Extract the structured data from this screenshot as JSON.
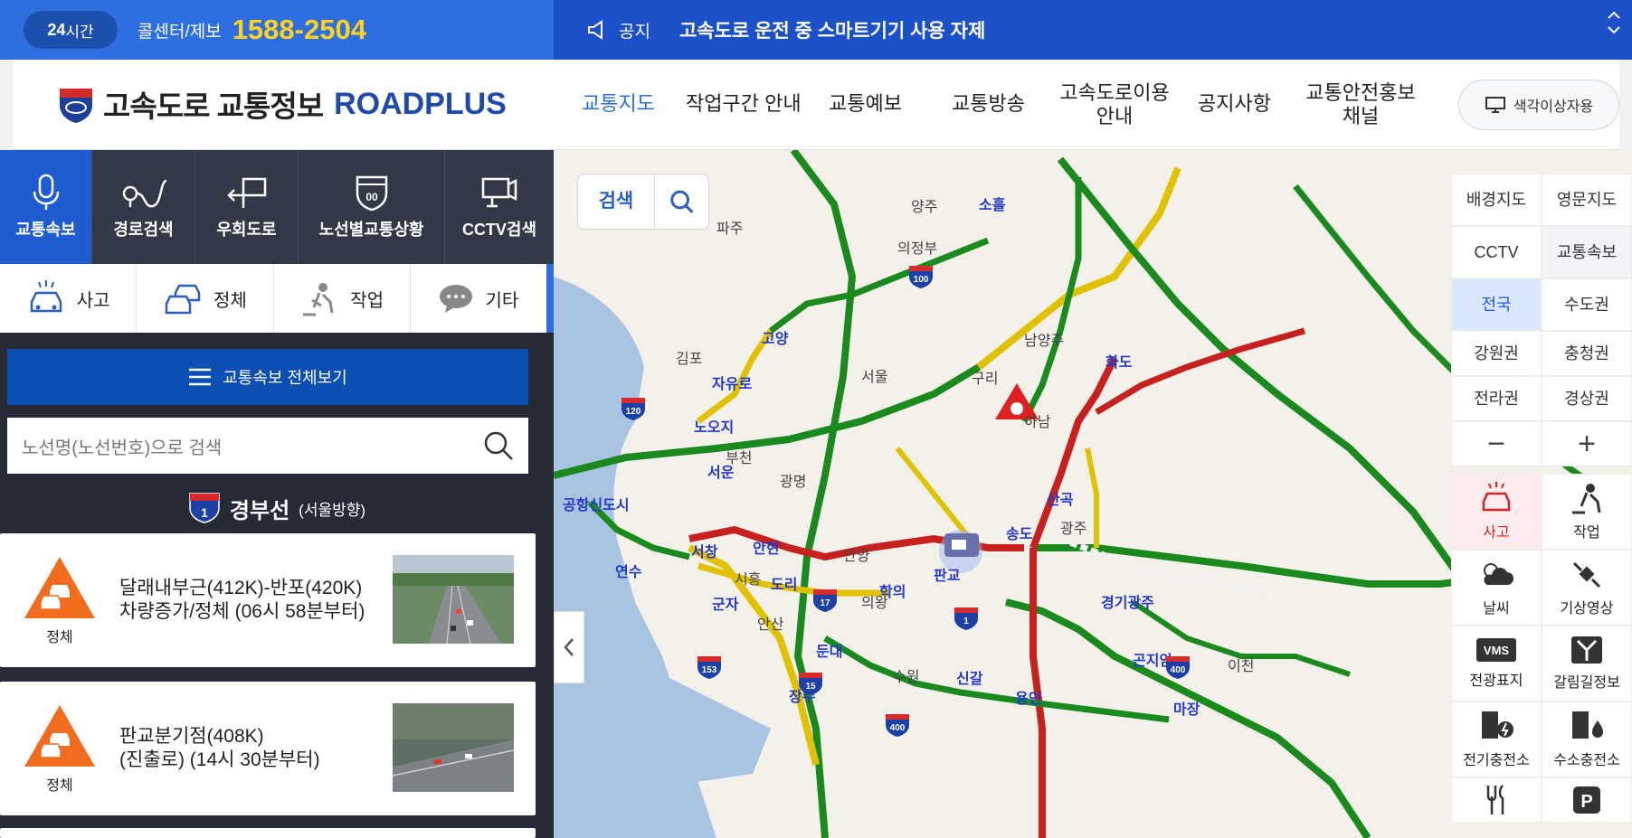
{
  "topbar": {
    "badge_bold": "24",
    "badge_light": "시간",
    "call_label": "콜센터/제보",
    "phone": "1588-2504",
    "notice_label": "공지",
    "notice_text": "고속도로 운전 중 스마트기기 사용 자제"
  },
  "header": {
    "logo_text": "고속도로 교통정보",
    "logo_brand": "ROADPLUS",
    "nav": [
      "교통지도",
      "작업구간 안내",
      "교통예보",
      "교통방송",
      "고속도로이용안내",
      "공지사항",
      "교통안전홍보채널"
    ],
    "color_btn": "색각이상자용"
  },
  "sidebar": {
    "tabs": [
      "교통속보",
      "경로검색",
      "우회도로",
      "노선별교통상황",
      "CCTV검색"
    ],
    "cats": [
      "사고",
      "정체",
      "작업",
      "기타"
    ],
    "view_all": "교통속보 전체보기",
    "search_placeholder": "노선명(노선번호)으로 검색",
    "route_no": "1",
    "route_name": "경부선",
    "route_dir": "(서울방향)",
    "items": [
      {
        "status": "정체",
        "line1": "달래내부근(412K)-반포(420K)",
        "line2": "차량증가/정체 (06시 58분부터)"
      },
      {
        "status": "정체",
        "line1": "판교분기점(408K)",
        "line2": "(진출로) (14시 30분부터)"
      }
    ]
  },
  "map": {
    "search_label": "검색",
    "region_buttons": [
      "배경지도",
      "영문지도",
      "CCTV",
      "교통속보",
      "전국",
      "수도권",
      "강원권",
      "충청권",
      "전라권",
      "경상권",
      "−",
      "+"
    ],
    "layer_buttons": [
      "사고",
      "작업",
      "날씨",
      "기상영상",
      "전광표지",
      "갈림길정보",
      "전기충전소",
      "수소충전소"
    ],
    "places": [
      "양주",
      "파주",
      "의정부",
      "소흘",
      "김포",
      "고양",
      "서울",
      "남양주",
      "구리",
      "하남",
      "화도",
      "자유로",
      "노오지",
      "부천",
      "광명",
      "공항신도시",
      "시흥",
      "안산",
      "안양",
      "의왕",
      "판교",
      "광주",
      "산곡",
      "경기광주",
      "이천",
      "수원",
      "용인",
      "신갈",
      "군자",
      "연수",
      "서창",
      "안현",
      "도리",
      "학의",
      "곤지암",
      "송도",
      "마장",
      "둔대",
      "서운",
      "장수"
    ],
    "shields": [
      "100",
      "120",
      "17",
      "1",
      "153",
      "15",
      "400",
      "400"
    ]
  }
}
